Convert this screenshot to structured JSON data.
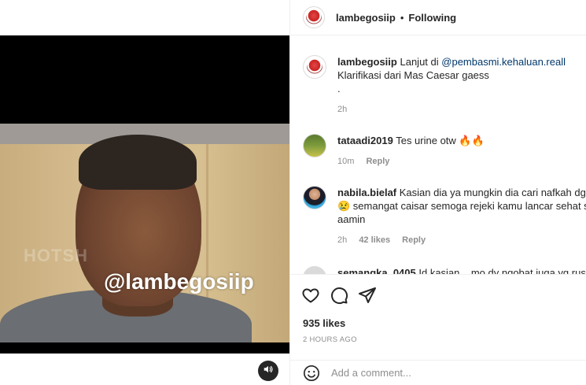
{
  "post": {
    "author": "lambegosiip",
    "follow_state": "Following",
    "separator": "•",
    "video_watermark": "@lambegosiip",
    "video_watermark_faint": "HOTSH",
    "likes": "935 likes",
    "posted": "2 HOURS AGO"
  },
  "caption": {
    "user": "lambegosiip",
    "text_prefix": "Lanjut di",
    "mention": "@pembasmi.kehaluan.reall",
    "line2": "Klarifikasi dari Mas Caesar gaess",
    "line3": ".",
    "time": "2h"
  },
  "comments": [
    {
      "user": "tataadi2019",
      "text": "Tes urine otw 🔥🔥",
      "time": "10m",
      "likes": "",
      "reply": "Reply"
    },
    {
      "user": "nabila.bielaf",
      "line1": "Kasian dia ya mungkin dia cari nafkah dgn c",
      "line2": "😢 semangat caisar semoga rejeki kamu lancar sehat sel",
      "line3": "aamin",
      "time": "2h",
      "likes": "42 likes",
      "reply": "Reply"
    },
    {
      "user": "semangka_0405",
      "text": " Id kasian... mo dy ngobat juga yg rusak"
    }
  ],
  "composer": {
    "placeholder": "Add a comment..."
  },
  "icons": {
    "like": "heart-icon",
    "comment": "comment-icon",
    "share": "share-icon",
    "emoji": "emoji-icon",
    "mute": "speaker-icon"
  }
}
